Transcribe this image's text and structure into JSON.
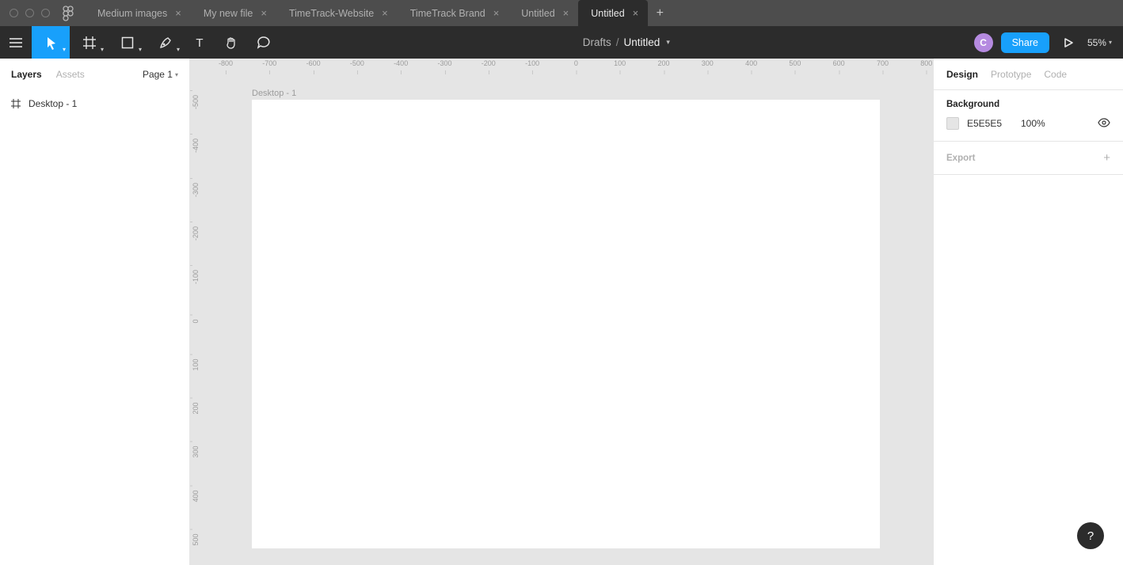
{
  "tabs": [
    {
      "label": "Medium images"
    },
    {
      "label": "My new file"
    },
    {
      "label": "TimeTrack-Website"
    },
    {
      "label": "TimeTrack Brand"
    },
    {
      "label": "Untitled"
    },
    {
      "label": "Untitled",
      "active": true
    }
  ],
  "breadcrumb": {
    "location": "Drafts",
    "file": "Untitled"
  },
  "avatar_letter": "C",
  "share_label": "Share",
  "zoom": "55%",
  "left_tabs": {
    "layers": "Layers",
    "assets": "Assets",
    "page": "Page 1"
  },
  "layers": [
    {
      "name": "Desktop - 1"
    }
  ],
  "frame_label": "Desktop - 1",
  "ruler_h": [
    "-800",
    "-700",
    "-600",
    "-500",
    "-400",
    "-300",
    "-200",
    "-100",
    "0",
    "100",
    "200",
    "300",
    "400",
    "500",
    "600",
    "700",
    "800"
  ],
  "ruler_v": [
    "-500",
    "-400",
    "-300",
    "-200",
    "-100",
    "0",
    "100",
    "200",
    "300",
    "400",
    "500"
  ],
  "right_tabs": {
    "design": "Design",
    "prototype": "Prototype",
    "code": "Code"
  },
  "background": {
    "title": "Background",
    "hex": "E5E5E5",
    "opacity": "100%"
  },
  "export_label": "Export"
}
